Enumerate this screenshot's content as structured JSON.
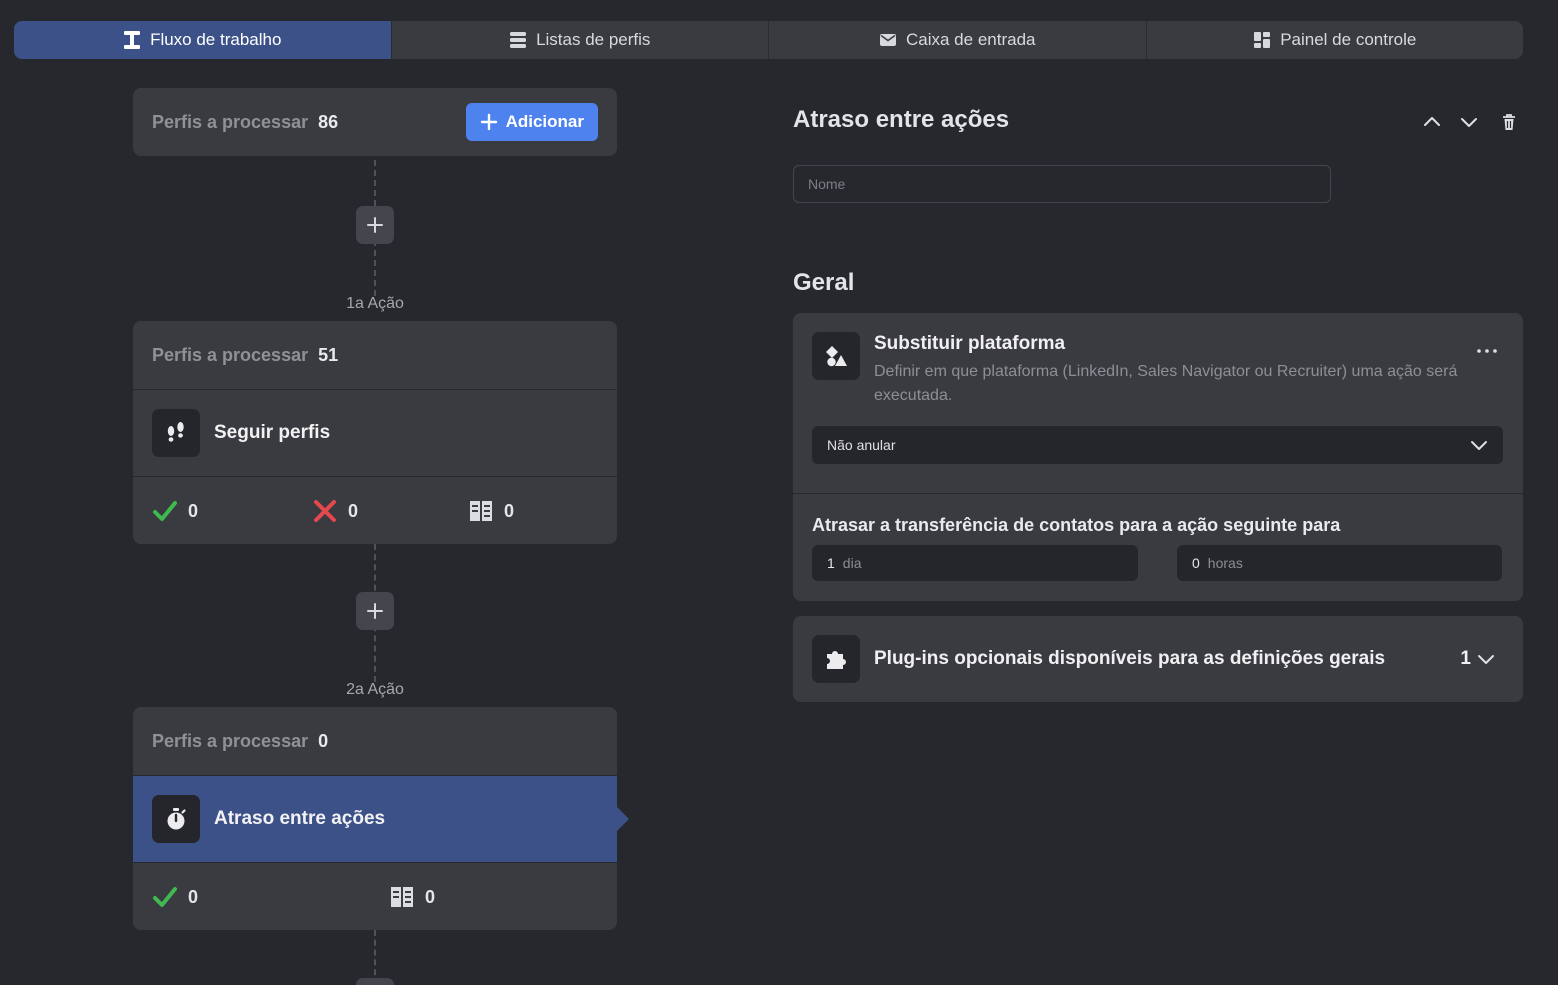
{
  "tabs": [
    {
      "label": "Fluxo de trabalho",
      "icon": "workflow-icon",
      "active": true
    },
    {
      "label": "Listas de perfis",
      "icon": "list-icon",
      "active": false
    },
    {
      "label": "Caixa de entrada",
      "icon": "envelope-icon",
      "active": false
    },
    {
      "label": "Painel de controle",
      "icon": "dashboard-icon",
      "active": false
    }
  ],
  "workflow": {
    "source": {
      "label": "Perfis a processar",
      "count": "86",
      "add_button": "Adicionar"
    },
    "steps": [
      {
        "step_label": "1a Ação",
        "queue_label": "Perfis a processar",
        "queue_count": "51",
        "action": "Seguir perfis",
        "icon": "footprints-icon",
        "stats": {
          "success": "0",
          "failed": "0",
          "skipped": "0"
        }
      },
      {
        "step_label": "2a Ação",
        "queue_label": "Perfis a processar",
        "queue_count": "0",
        "action": "Atraso entre ações",
        "icon": "stopwatch-icon",
        "selected": true,
        "stats": {
          "success": "0",
          "skipped": "0"
        }
      }
    ]
  },
  "panel": {
    "title": "Atraso entre ações",
    "name_placeholder": "Nome",
    "section": "Geral",
    "platform": {
      "title": "Substituir plataforma",
      "description": "Definir em que plataforma (LinkedIn, Sales Navigator ou Recruiter) uma ação será executada.",
      "selected": "Não anular"
    },
    "delay": {
      "label": "Atrasar a transferência de contatos para a ação seguinte para",
      "days_value": "1",
      "days_unit": "dia",
      "hours_value": "0",
      "hours_unit": "horas"
    },
    "plugins": {
      "label": "Plug-ins opcionais disponíveis para as definições gerais",
      "count": "1"
    }
  },
  "colors": {
    "background": "#27282d",
    "card": "#3a3b41",
    "accent_active": "#3b5188",
    "primary_button": "#4e82ef",
    "success": "#3fb950",
    "error": "#e5484d"
  }
}
